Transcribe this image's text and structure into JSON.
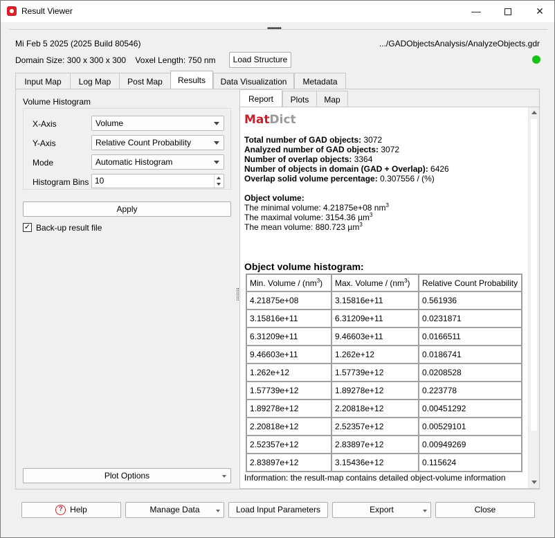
{
  "window": {
    "title": "Result Viewer"
  },
  "header": {
    "date_build": "Mi Feb 5 2025 (2025 Build 80546)",
    "path": ".../GADObjectsAnalysis/AnalyzeObjects.gdr",
    "domain_info": "Domain Size: 300 x 300 x 300    Voxel Length: 750 nm",
    "load_structure": "Load Structure",
    "status_color": "#17c217"
  },
  "tabs": [
    "Input Map",
    "Log Map",
    "Post Map",
    "Results",
    "Data Visualization",
    "Metadata"
  ],
  "active_tab": "Results",
  "left": {
    "title": "Volume Histogram",
    "x_axis_label": "X-Axis",
    "x_axis_value": "Volume",
    "y_axis_label": "Y-Axis",
    "y_axis_value": "Relative Count Probability",
    "mode_label": "Mode",
    "mode_value": "Automatic Histogram",
    "bins_label": "Histogram Bins",
    "bins_value": "10",
    "apply": "Apply",
    "backup_label": "Back-up result file",
    "backup_checked": true,
    "plot_options": "Plot Options"
  },
  "subtabs": [
    "Report",
    "Plots",
    "Map"
  ],
  "active_subtab": "Report",
  "report": {
    "logo_mat": "Mat",
    "logo_dict": "Dict",
    "stats": [
      {
        "label": "Total number of GAD objects:",
        "value": " 3072"
      },
      {
        "label": "Analyzed number of GAD objects:",
        "value": " 3072"
      },
      {
        "label": "Number of overlap objects:",
        "value": " 3364"
      },
      {
        "label": "Number of objects in domain (GAD + Overlap):",
        "value": " 6426"
      },
      {
        "label": "Overlap solid volume percentage:",
        "value": " 0.307556 / (%)"
      }
    ],
    "object_volume_title": "Object volume:",
    "min_volume": "The minimal volume: 4.21875e+08 nm",
    "max_volume": "The maximal volume: 3154.36 µm",
    "mean_volume": "The mean volume: 880.723 µm",
    "sup3": "3",
    "histogram_title": "Object volume histogram:",
    "table_headers": [
      "Min. Volume / (nm",
      "Max. Volume / (nm",
      "Relative Count Probability"
    ],
    "header_paren": ")",
    "table_rows": [
      [
        "4.21875e+08",
        "3.15816e+11",
        "0.561936"
      ],
      [
        "3.15816e+11",
        "6.31209e+11",
        "0.0231871"
      ],
      [
        "6.31209e+11",
        "9.46603e+11",
        "0.0166511"
      ],
      [
        "9.46603e+11",
        "1.262e+12",
        "0.0186741"
      ],
      [
        "1.262e+12",
        "1.57739e+12",
        "0.0208528"
      ],
      [
        "1.57739e+12",
        "1.89278e+12",
        "0.223778"
      ],
      [
        "1.89278e+12",
        "2.20818e+12",
        "0.00451292"
      ],
      [
        "2.20818e+12",
        "2.52357e+12",
        "0.00529101"
      ],
      [
        "2.52357e+12",
        "2.83897e+12",
        "0.00949269"
      ],
      [
        "2.83897e+12",
        "3.15436e+12",
        "0.115624"
      ]
    ],
    "info_footer": "Information: the result-map contains detailed object-volume information"
  },
  "footer": {
    "help": "Help",
    "manage_data": "Manage Data",
    "load_input": "Load Input Parameters",
    "export": "Export",
    "close": "Close"
  }
}
